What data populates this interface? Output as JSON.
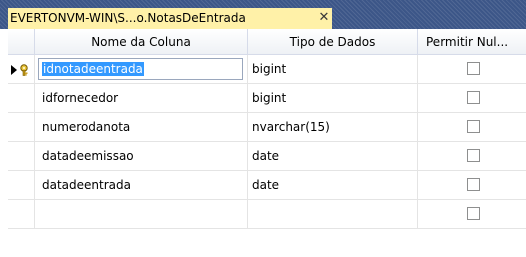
{
  "tab": {
    "title": "EVERTONVM-WIN\\S...o.NotasDeEntrada",
    "close_glyph": "✕"
  },
  "columns": [
    "Nome da Coluna",
    "Tipo de Dados",
    "Permitir Nul..."
  ],
  "rows": [
    {
      "name": "idnotadeentrada",
      "type": "bigint",
      "allow_nulls": false,
      "primary_key": true,
      "selected": true
    },
    {
      "name": "idfornecedor",
      "type": "bigint",
      "allow_nulls": false
    },
    {
      "name": "numerodanota",
      "type": "nvarchar(15)",
      "allow_nulls": false
    },
    {
      "name": "datadeemissao",
      "type": "date",
      "allow_nulls": false
    },
    {
      "name": "datadeentrada",
      "type": "date",
      "allow_nulls": false
    },
    {
      "name": "",
      "type": "",
      "allow_nulls": false
    }
  ],
  "colors": {
    "tab_strip": "#3c5688",
    "active_tab": "#fff1a8",
    "selection": "#3399ff"
  },
  "icons": {
    "row_indicator": "selected-row-arrow-icon",
    "primary_key": "primary-key-icon"
  }
}
